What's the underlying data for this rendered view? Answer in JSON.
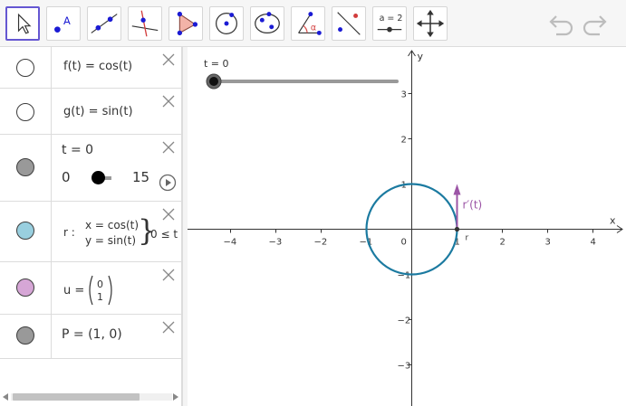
{
  "toolbar": {
    "tools": [
      {
        "name": "move",
        "label": ""
      },
      {
        "name": "point",
        "label": "A"
      },
      {
        "name": "line",
        "label": ""
      },
      {
        "name": "perpendicular-line",
        "label": ""
      },
      {
        "name": "polygon",
        "label": ""
      },
      {
        "name": "circle-center-point",
        "label": ""
      },
      {
        "name": "ellipse",
        "label": ""
      },
      {
        "name": "angle",
        "label": "α"
      },
      {
        "name": "reflect",
        "label": ""
      },
      {
        "name": "slider",
        "label": "a = 2"
      },
      {
        "name": "move-graphics-view",
        "label": ""
      }
    ],
    "selected": "move"
  },
  "algebra": {
    "rows": [
      {
        "id": "f",
        "text": "f(t) = cos(t)",
        "marble_color": "#ffffff"
      },
      {
        "id": "g",
        "text": "g(t) = sin(t)",
        "marble_color": "#ffffff"
      },
      {
        "id": "t",
        "text": "t = 0",
        "marble_color": "#999999",
        "slider": {
          "min": "0",
          "max": "15",
          "value": 0
        }
      },
      {
        "id": "r",
        "name": "r :",
        "line1": "x = cos(t)",
        "line2": "y = sin(t)",
        "condition": "0 ≤ t",
        "marble_color": "#99cfdf"
      },
      {
        "id": "u",
        "name": "u =",
        "vec_top": "0",
        "vec_bottom": "1",
        "marble_color": "#d6a6d6"
      },
      {
        "id": "P",
        "text": "P = (1, 0)",
        "marble_color": "#999999"
      }
    ]
  },
  "graphics": {
    "slider_label": "t = 0",
    "slider_value_fraction": 0,
    "x_axis_label": "x",
    "y_axis_label": "y",
    "x_ticks": [
      "−4",
      "−3",
      "−2",
      "−1",
      "0",
      "1",
      "2",
      "3",
      "4"
    ],
    "y_ticks": [
      "3",
      "2",
      "1",
      "−1",
      "−2",
      "−3"
    ],
    "curve_color": "#1b7aa0",
    "vector_color": "#9c55a6",
    "vector_label": "r′(t)",
    "point_label": "r",
    "x_range": [
      -4.9,
      4.9
    ],
    "y_range": [
      -3.8,
      4.1
    ]
  }
}
